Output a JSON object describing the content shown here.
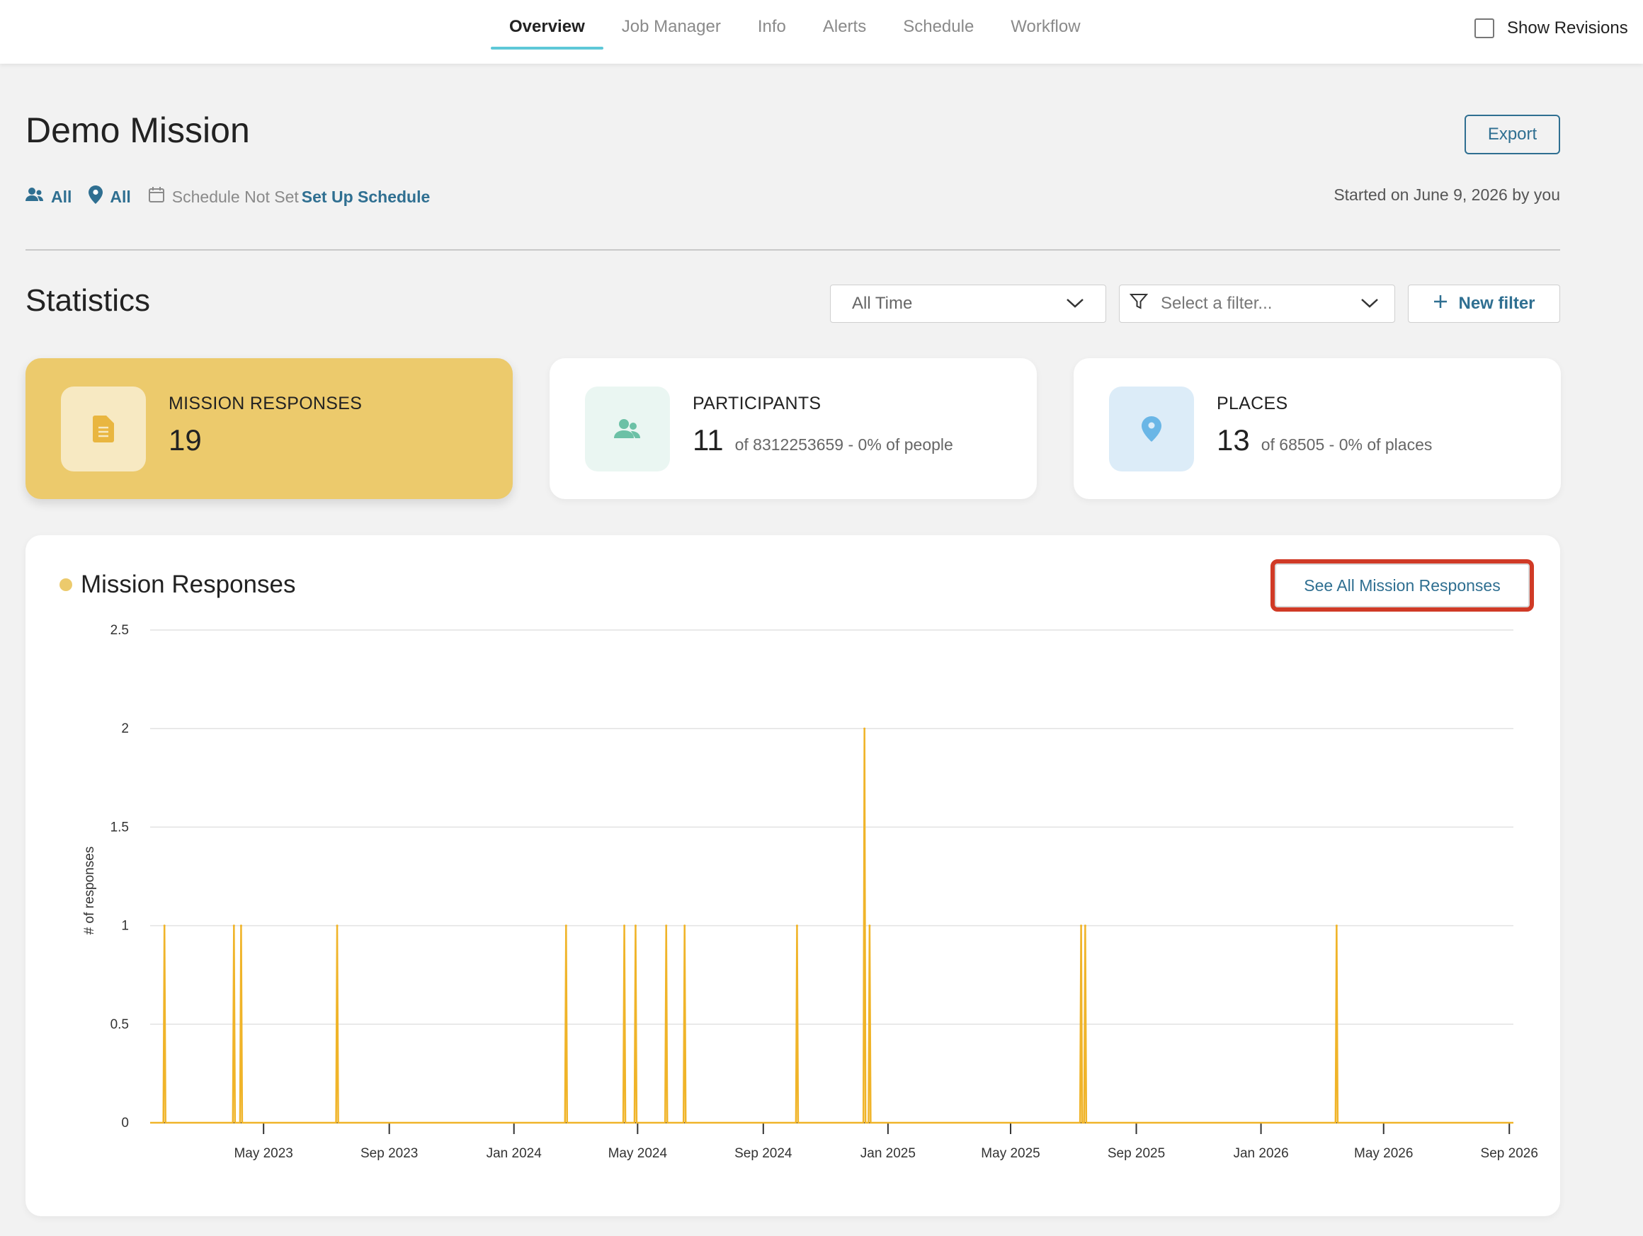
{
  "nav": {
    "tabs": [
      {
        "label": "Overview",
        "active": true
      },
      {
        "label": "Job Manager",
        "active": false
      },
      {
        "label": "Info",
        "active": false
      },
      {
        "label": "Alerts",
        "active": false
      },
      {
        "label": "Schedule",
        "active": false
      },
      {
        "label": "Workflow",
        "active": false
      }
    ],
    "show_revisions_label": "Show Revisions",
    "show_revisions_checked": false
  },
  "header": {
    "title": "Demo Mission",
    "export_label": "Export",
    "participants_filter": "All",
    "places_filter": "All",
    "schedule_status": "Schedule Not Set",
    "setup_schedule_label": "Set Up Schedule",
    "started": "Started on June 9, 2026 by you"
  },
  "statistics": {
    "title": "Statistics",
    "time_range": "All Time",
    "filter_placeholder": "Select a filter...",
    "new_filter_label": "New filter",
    "cards": [
      {
        "label": "MISSION RESPONSES",
        "value": "19",
        "sub": "",
        "icon": "document-icon"
      },
      {
        "label": "PARTICIPANTS",
        "value": "11",
        "sub": "of 8312253659 - 0% of people",
        "icon": "people-icon"
      },
      {
        "label": "PLACES",
        "value": "13",
        "sub": "of 68505 - 0% of places",
        "icon": "location-pin-icon"
      }
    ]
  },
  "chart_section": {
    "title": "Mission Responses",
    "see_all_label": "See All Mission Responses"
  },
  "colors": {
    "accent": "#2f6f91",
    "responses_yellow": "#ecca6c",
    "bar_line": "#f0b429",
    "tab_underline": "#5ec8d8",
    "highlight_box": "#d03a26"
  },
  "chart_data": {
    "type": "line",
    "ylabel": "# of responses",
    "ylim": [
      0,
      2.5
    ],
    "yticks": [
      "0",
      "0.5",
      "1",
      "1.5",
      "2",
      "2.5"
    ],
    "xlim": [
      "2023-01-10",
      "2026-09-05"
    ],
    "xticks": [
      {
        "date": "2023-05-01",
        "label": "May 2023"
      },
      {
        "date": "2023-09-01",
        "label": "Sep 2023"
      },
      {
        "date": "2024-01-01",
        "label": "Jan 2024"
      },
      {
        "date": "2024-05-01",
        "label": "May 2024"
      },
      {
        "date": "2024-09-01",
        "label": "Sep 2024"
      },
      {
        "date": "2025-01-01",
        "label": "Jan 2025"
      },
      {
        "date": "2025-05-01",
        "label": "May 2025"
      },
      {
        "date": "2025-09-01",
        "label": "Sep 2025"
      },
      {
        "date": "2026-01-01",
        "label": "Jan 2026"
      },
      {
        "date": "2026-05-01",
        "label": "May 2026"
      },
      {
        "date": "2026-09-01",
        "label": "Sep 2026"
      }
    ],
    "series": [
      {
        "points": [
          {
            "x": "2023-01-24",
            "y": 1
          },
          {
            "x": "2023-04-02",
            "y": 1
          },
          {
            "x": "2023-04-09",
            "y": 1
          },
          {
            "x": "2023-07-12",
            "y": 1
          },
          {
            "x": "2024-02-21",
            "y": 1
          },
          {
            "x": "2024-04-18",
            "y": 1
          },
          {
            "x": "2024-04-29",
            "y": 1
          },
          {
            "x": "2024-05-29",
            "y": 1
          },
          {
            "x": "2024-06-16",
            "y": 1
          },
          {
            "x": "2024-10-04",
            "y": 1
          },
          {
            "x": "2024-12-09",
            "y": 2
          },
          {
            "x": "2024-12-14",
            "y": 1
          },
          {
            "x": "2025-07-09",
            "y": 1
          },
          {
            "x": "2025-07-13",
            "y": 1
          },
          {
            "x": "2026-03-16",
            "y": 1
          }
        ]
      }
    ]
  }
}
